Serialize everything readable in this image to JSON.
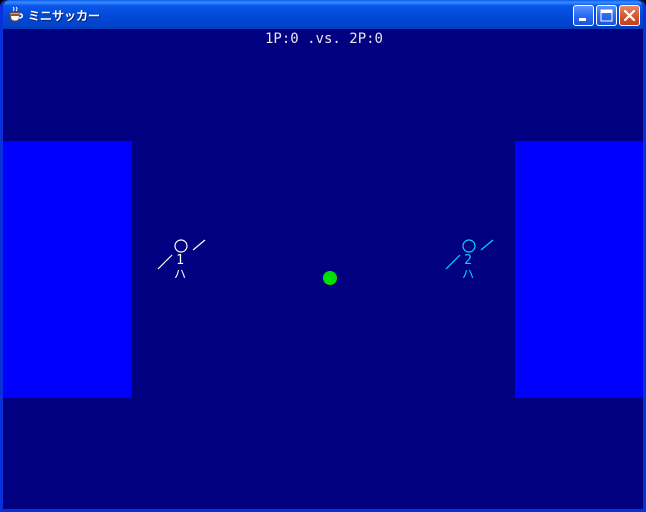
{
  "window": {
    "title": "ミニサッカー",
    "icon": "coffee-cup-icon",
    "buttons": [
      "minimize",
      "maximize",
      "close"
    ]
  },
  "scoreboard": {
    "text": "1P:0 .vs. 2P:0"
  },
  "players": [
    {
      "number": "1",
      "legs": "ハ",
      "color": "#ffffff"
    },
    {
      "number": "2",
      "legs": "ハ",
      "color": "#00d8ff"
    }
  ],
  "colors": {
    "field": "#000080",
    "goal": "#0000ff",
    "ball": "#00e000",
    "player1": "#ffffff",
    "player2": "#00d8ff"
  }
}
